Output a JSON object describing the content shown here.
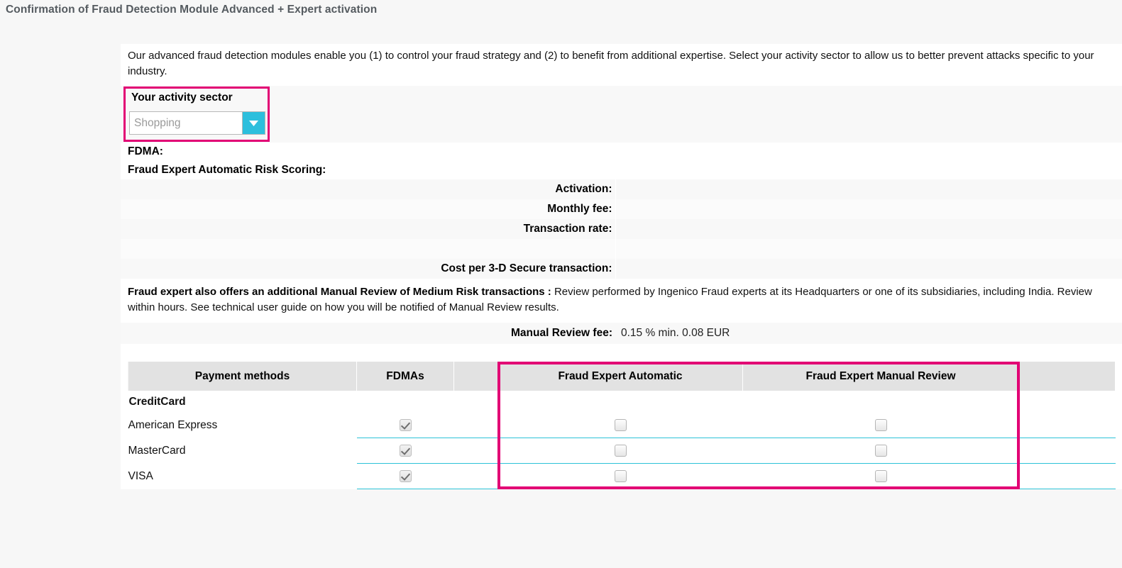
{
  "page": {
    "title": "Confirmation of Fraud Detection Module Advanced + Expert activation",
    "accent_pink": "#e20074",
    "accent_cyan": "#2dbfdd",
    "row_line_color": "#2dc3d8"
  },
  "intro": {
    "text": "Our advanced fraud detection modules enable you (1) to control your fraud strategy and (2) to benefit from additional expertise. Select your activity sector to allow us to better prevent attacks specific to your industry."
  },
  "sector": {
    "label": "Your activity sector",
    "selected": "Shopping",
    "placeholder": "Shopping",
    "arrow_icon": "chevron-down-icon"
  },
  "fdma": {
    "heading": "FDMA:",
    "subheading": "Fraud Expert Automatic Risk Scoring:",
    "rows": [
      {
        "label": "Activation:",
        "value": ""
      },
      {
        "label": "Monthly fee:",
        "value": ""
      },
      {
        "label": "Transaction rate:",
        "value": ""
      },
      {
        "label": "",
        "value": ""
      },
      {
        "label": "Cost per 3-D Secure transaction:",
        "value": ""
      }
    ]
  },
  "manual_review": {
    "paragraph_bold": "Fraud expert also offers an additional Manual Review of Medium Risk transactions :",
    "paragraph_rest": " Review performed by Ingenico Fraud experts at its Headquarters or one of its subsidiaries, including India. Review within hours. See technical user guide on how you will be notified of Manual Review results.",
    "fee_label": "Manual Review fee:",
    "fee_value": "0.15 % min. 0.08  EUR"
  },
  "payment_table": {
    "headers": [
      "Payment methods",
      "FDMAs",
      "",
      "Fraud Expert Automatic",
      "Fraud Expert Manual Review",
      ""
    ],
    "group_label": "CreditCard",
    "rows": [
      {
        "name": "American Express",
        "fdma": "checked-disabled",
        "fraud_expert_automatic": "unchecked",
        "fraud_expert_manual_review": "unchecked"
      },
      {
        "name": "MasterCard",
        "fdma": "checked-disabled",
        "fraud_expert_automatic": "unchecked",
        "fraud_expert_manual_review": "unchecked"
      },
      {
        "name": "VISA",
        "fdma": "checked-disabled",
        "fraud_expert_automatic": "unchecked",
        "fraud_expert_manual_review": "unchecked"
      }
    ]
  }
}
